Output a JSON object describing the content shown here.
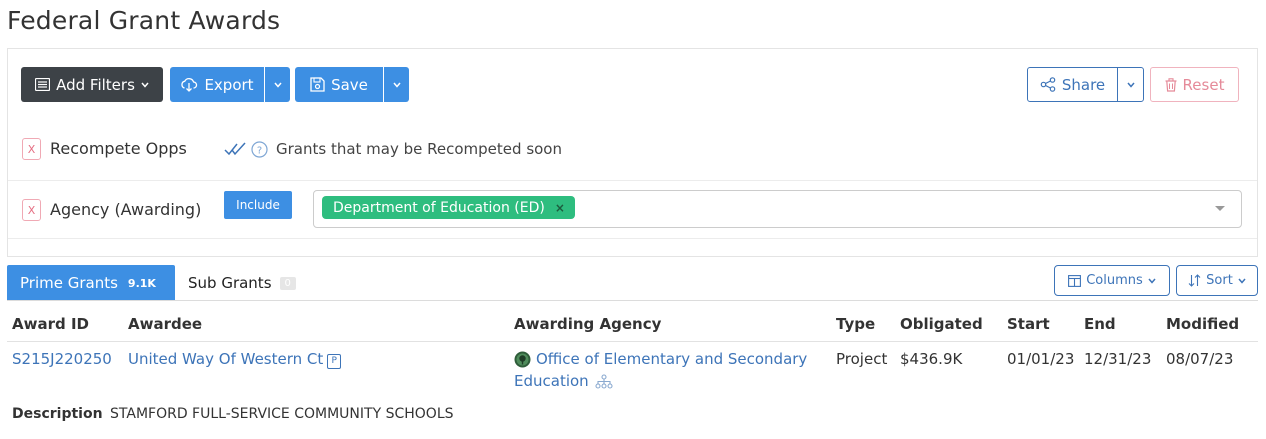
{
  "page": {
    "title": "Federal Grant Awards"
  },
  "toolbar": {
    "add_filters_label": "Add Filters",
    "export_label": "Export",
    "save_label": "Save",
    "share_label": "Share",
    "reset_label": "Reset"
  },
  "filters": {
    "recompete": {
      "remove_label": "X",
      "label": "Recompete Opps",
      "note": "Grants that may be Recompeted soon"
    },
    "agency": {
      "remove_label": "X",
      "label": "Agency (Awarding)",
      "mode_label": "Include",
      "selected_tag": "Department of Education (ED)",
      "tag_remove": "×"
    }
  },
  "tabs": [
    {
      "label": "Prime Grants",
      "count": "9.1K",
      "active": true
    },
    {
      "label": "Sub Grants",
      "count": "0",
      "active": false
    }
  ],
  "view_controls": {
    "columns_label": "Columns",
    "sort_label": "Sort"
  },
  "table": {
    "columns": [
      "Award ID",
      "Awardee",
      "Awarding Agency",
      "Type",
      "Obligated",
      "Start",
      "End",
      "Modified"
    ],
    "rows": [
      {
        "award_id": "S215J220250",
        "awardee": "United Way Of Western Ct",
        "awardee_badge": "P",
        "agency_line1": "Office of Elementary and Secondary",
        "agency_line2": "Education",
        "type": "Project",
        "obligated": "$436.9K",
        "start": "01/01/23",
        "end": "12/31/23",
        "modified": "08/07/23",
        "description_label": "Description",
        "description": "STAMFORD FULL-SERVICE COMMUNITY SCHOOLS"
      }
    ]
  },
  "colors": {
    "primary": "#3d8fe3",
    "dark_button": "#3d4247",
    "outline_blue": "#3d74b8",
    "tag_green": "#2ebd7f",
    "reset_pink": "#e58a99"
  },
  "icons": [
    "list-icon",
    "caret-down-icon",
    "cloud-download-icon",
    "floppy-disk-icon",
    "share-icon",
    "trash-icon",
    "double-check-icon",
    "question-circle-icon",
    "columns-icon",
    "sort-icon",
    "agency-seal-icon",
    "hierarchy-icon"
  ]
}
